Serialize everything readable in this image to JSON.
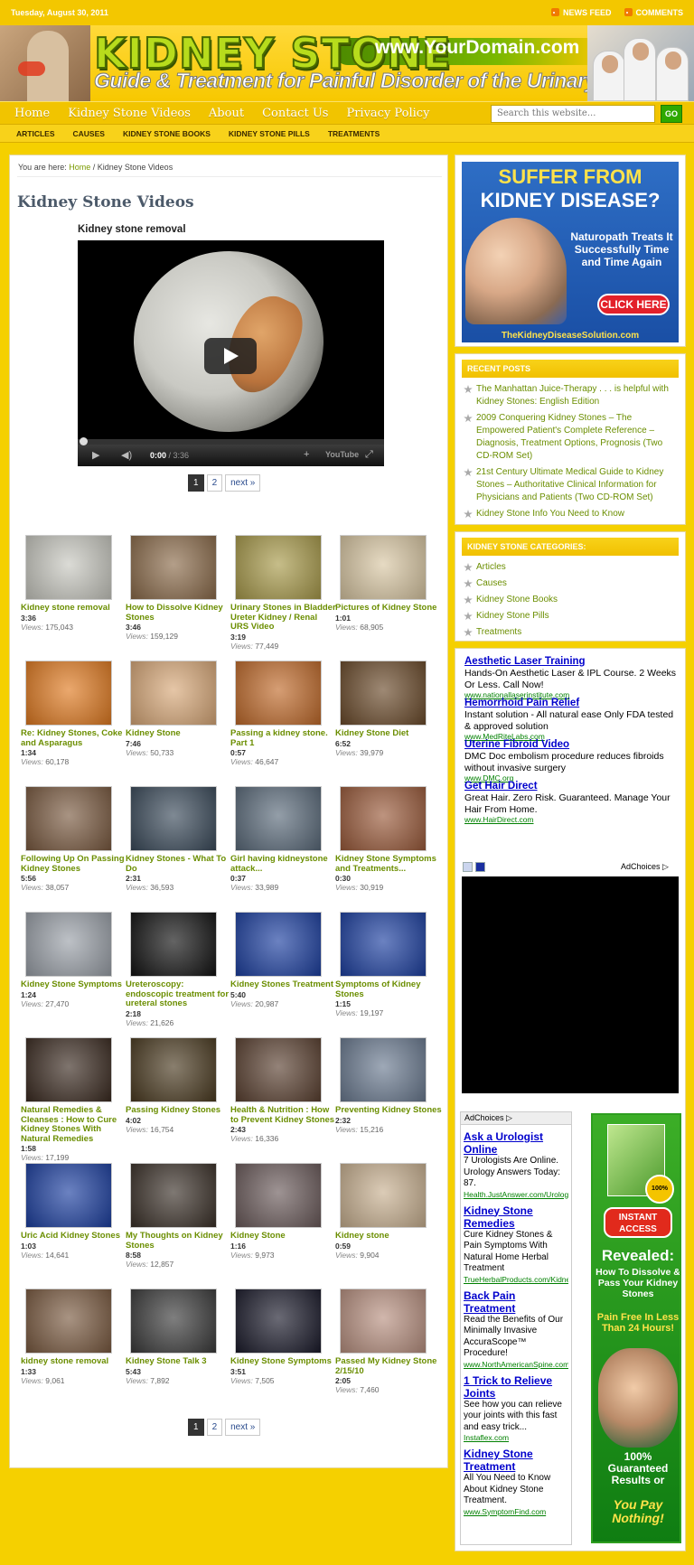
{
  "topbar": {
    "date": "Tuesday, August 30, 2011",
    "news_feed": "NEWS FEED",
    "comments": "COMMENTS"
  },
  "header": {
    "logo": "KIDNEY STONE",
    "domain": "www.YourDomain.com",
    "tagline": "Guide & Treatment for Painful Disorder of the Urinary Tract"
  },
  "nav": {
    "items": [
      "Home",
      "Kidney Stone Videos",
      "About",
      "Contact Us",
      "Privacy Policy"
    ],
    "search_placeholder": "Search this website...",
    "go": "GO"
  },
  "subnav": {
    "items": [
      "ARTICLES",
      "CAUSES",
      "KIDNEY STONE BOOKS",
      "KIDNEY STONE PILLS",
      "TREATMENTS"
    ]
  },
  "breadcrumb": {
    "prefix": "You are here:",
    "home": "Home",
    "sep": "/",
    "current": "Kidney Stone Videos"
  },
  "page_title": "Kidney Stone Videos",
  "player": {
    "title": "Kidney stone removal",
    "time_current": "0:00",
    "time_total": "/ 3:36",
    "brand": "YouTube"
  },
  "pager": {
    "page1": "1",
    "page2": "2",
    "next": "next »"
  },
  "views_label": "Views:",
  "videos": [
    {
      "name": "Kidney stone removal",
      "dur": "3:36",
      "views": "175,043",
      "thumb": "#c8c8c0"
    },
    {
      "name": "How to Dissolve Kidney Stones",
      "dur": "3:46",
      "views": "159,129",
      "thumb": "#8b6b4a"
    },
    {
      "name": "Urinary Stones in Bladder Ureter Kidney / Renal URS Video",
      "dur": "3:19",
      "views": "77,449",
      "thumb": "#a89a4a"
    },
    {
      "name": "Pictures of Kidney Stone",
      "dur": "1:01",
      "views": "68,905",
      "thumb": "#d9c7a3"
    },
    {
      "name": "Re: Kidney Stones, Coke and Asparagus",
      "dur": "1:34",
      "views": "60,178",
      "thumb": "#e07a20"
    },
    {
      "name": "Kidney Stone",
      "dur": "7:46",
      "views": "50,733",
      "thumb": "#d8a878"
    },
    {
      "name": "Passing a kidney stone. Part 1",
      "dur": "0:57",
      "views": "46,647",
      "thumb": "#c06a2a"
    },
    {
      "name": "Kidney Stone Diet",
      "dur": "6:52",
      "views": "39,979",
      "thumb": "#6a4a2a"
    },
    {
      "name": "Following Up On Passing Kidney Stones",
      "dur": "5:56",
      "views": "38,057",
      "thumb": "#7a5a40"
    },
    {
      "name": "Kidney Stones - What To Do",
      "dur": "2:31",
      "views": "36,593",
      "thumb": "#3a4a5a"
    },
    {
      "name": "Girl having kidneystone attack...",
      "dur": "0:37",
      "views": "33,989",
      "thumb": "#5a6a7a"
    },
    {
      "name": "Kidney Stone Symptoms and Treatments...",
      "dur": "0:30",
      "views": "30,919",
      "thumb": "#9a5a3a"
    },
    {
      "name": "Kidney Stone Symptoms",
      "dur": "1:24",
      "views": "27,470",
      "thumb": "#9aa0a8"
    },
    {
      "name": "Ureteroscopy: endoscopic treatment for ureteral stones",
      "dur": "2:18",
      "views": "21,626",
      "thumb": "#111111"
    },
    {
      "name": "Kidney Stones Treatment",
      "dur": "5:40",
      "views": "20,987",
      "thumb": "#1c3fa0"
    },
    {
      "name": "Symptoms of Kidney Stones",
      "dur": "1:15",
      "views": "19,197",
      "thumb": "#1c3fa0"
    },
    {
      "name": "Natural Remedies & Cleanses : How to Cure Kidney Stones With Natural Remedies",
      "dur": "1:58",
      "views": "17,199",
      "thumb": "#3a2a20"
    },
    {
      "name": "Passing Kidney Stones",
      "dur": "4:02",
      "views": "16,754",
      "thumb": "#4a3a20"
    },
    {
      "name": "Health & Nutrition : How to Prevent Kidney Stones",
      "dur": "2:43",
      "views": "16,336",
      "thumb": "#5a4030"
    },
    {
      "name": "Preventing Kidney Stones",
      "dur": "2:32",
      "views": "15,216",
      "thumb": "#6a7a90"
    },
    {
      "name": "Uric Acid Kidney Stones",
      "dur": "1:03",
      "views": "14,641",
      "thumb": "#1c3fa0"
    },
    {
      "name": "My Thoughts on Kidney Stones",
      "dur": "8:58",
      "views": "12,857",
      "thumb": "#3a3028"
    },
    {
      "name": "Kidney Stone",
      "dur": "1:16",
      "views": "9,973",
      "thumb": "#6a5a5a"
    },
    {
      "name": "Kidney stone",
      "dur": "0:59",
      "views": "9,904",
      "thumb": "#c8b090"
    },
    {
      "name": "kidney stone removal",
      "dur": "1:33",
      "views": "9,061",
      "thumb": "#7a5a40"
    },
    {
      "name": "Kidney Stone Talk 3",
      "dur": "5:43",
      "views": "7,892",
      "thumb": "#3a3a3a"
    },
    {
      "name": "Kidney Stone Symptoms",
      "dur": "3:51",
      "views": "7,505",
      "thumb": "#1a1a2a"
    },
    {
      "name": "Passed My Kidney Stone 2/15/10",
      "dur": "2:05",
      "views": "7,460",
      "thumb": "#b89080"
    }
  ],
  "ad1": {
    "line1": "SUFFER FROM",
    "line2": "KIDNEY DISEASE?",
    "text": "Naturopath Treats It Successfully Time and Time Again",
    "cta": "CLICK HERE",
    "url": "TheKidneyDiseaseSolution.com"
  },
  "recent_posts": {
    "heading": "RECENT POSTS",
    "items": [
      "The Manhattan Juice-Therapy . . . is helpful with Kidney Stones: English Edition",
      "2009 Conquering Kidney Stones – The Empowered Patient's Complete Reference – Diagnosis, Treatment Options, Prognosis (Two CD-ROM Set)",
      "21st Century Ultimate Medical Guide to Kidney Stones – Authoritative Clinical Information for Physicians and Patients (Two CD-ROM Set)",
      "Kidney Stone Info You Need to Know"
    ]
  },
  "categories": {
    "heading": "KIDNEY STONE CATEGORIES:",
    "items": [
      "Articles",
      "Causes",
      "Kidney Stone Books",
      "Kidney Stone Pills",
      "Treatments"
    ]
  },
  "ads2": [
    {
      "title": "Aesthetic Laser Training",
      "desc": "Hands-On Aesthetic Laser & IPL Course. 2 Weeks Or Less. Call Now!",
      "url": "www.nationallaserinstitute.com"
    },
    {
      "title": "Hemorrhoid Pain Relief",
      "desc": "Instant solution - All natural ease Only FDA tested & approved solution",
      "url": "www.MedRiteLabs.com"
    },
    {
      "title": "Uterine Fibroid Video",
      "desc": "DMC Doc embolism procedure reduces fibroids without invasive surgery",
      "url": "www.DMC.org"
    },
    {
      "title": "Get Hair Direct",
      "desc": "Great Hair. Zero Risk. Guaranteed. Manage Your Hair From Home.",
      "url": "www.HairDirect.com"
    }
  ],
  "adchoices": "AdChoices",
  "ads3": [
    {
      "title": "Ask a Urologist Online",
      "desc": "7 Urologists Are Online. Urology Answers Today: 87.",
      "url": "Health.JustAnswer.com/Urology"
    },
    {
      "title": "Kidney Stone Remedies",
      "desc": "Cure Kidney Stones & Pain Symptoms With Natural Home Herbal Treatment",
      "url": "TrueHerbalProducts.com/Kidney"
    },
    {
      "title": "Back Pain Treatment",
      "desc": "Read the Benefits of Our Minimally Invasive AccuraScope™ Procedure!",
      "url": "www.NorthAmericanSpine.com"
    },
    {
      "title": "1 Trick to Relieve Joints",
      "desc": "See how you can relieve your joints with this fast and easy trick...",
      "url": "Instaflex.com"
    },
    {
      "title": "Kidney Stone Treatment",
      "desc": "All You Need to Know About Kidney Stone Treatment.",
      "url": "www.SymptomFind.com"
    }
  ],
  "ad4": {
    "seal": "100%",
    "btn": "INSTANT ACCESS",
    "rev": "Revealed:",
    "sub": "How To Dissolve & Pass Your Kidney Stones",
    "pf": "Pain Free In Less Than 24 Hours!",
    "g1": "100% Guaranteed Results or",
    "g2": "You Pay Nothing!"
  }
}
